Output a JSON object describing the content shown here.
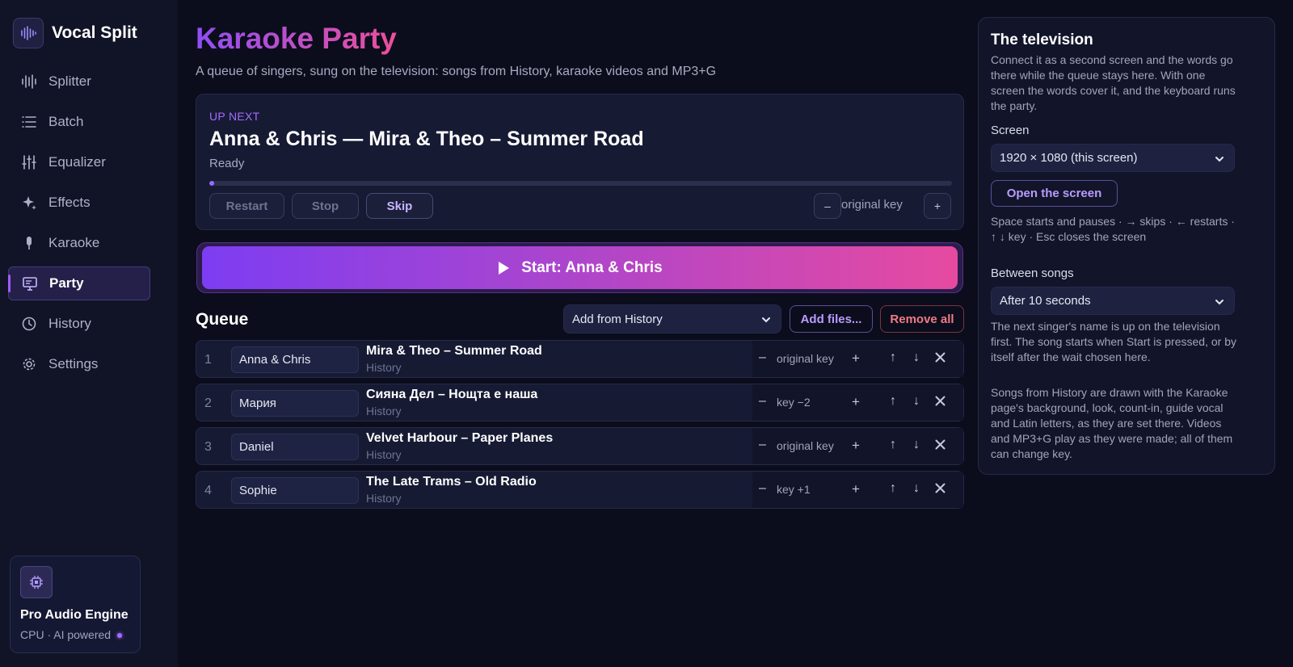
{
  "app": {
    "name": "Vocal Split"
  },
  "sidebar": {
    "items": [
      {
        "label": "Splitter",
        "icon": "waveform-icon"
      },
      {
        "label": "Batch",
        "icon": "list-icon"
      },
      {
        "label": "Equalizer",
        "icon": "sliders-icon"
      },
      {
        "label": "Effects",
        "icon": "sparkle-icon"
      },
      {
        "label": "Karaoke",
        "icon": "microphone-icon"
      },
      {
        "label": "Party",
        "icon": "monitor-icon",
        "active": true
      },
      {
        "label": "History",
        "icon": "clock-icon"
      },
      {
        "label": "Settings",
        "icon": "gear-icon"
      }
    ],
    "engine": {
      "title": "Pro Audio Engine",
      "subtitle": "CPU · AI powered"
    }
  },
  "header": {
    "title": "Karaoke Party",
    "subtitle": "A queue of singers, sung on the television: songs from History, karaoke videos and MP3+G"
  },
  "up_next": {
    "label": "UP NEXT",
    "title": "Anna & Chris — Mira & Theo – Summer Road",
    "status": "Ready",
    "progress": 0.006,
    "buttons": {
      "restart": "Restart",
      "stop": "Stop",
      "skip": "Skip"
    },
    "key": {
      "minus": "–",
      "label": "original key",
      "plus": "+"
    }
  },
  "start_button": {
    "label": "Start: Anna & Chris"
  },
  "queue": {
    "title": "Queue",
    "add_from": "Add from History",
    "add_files": "Add files...",
    "remove_all": "Remove all",
    "rows": [
      {
        "num": "1",
        "singer": "Anna & Chris",
        "song": "Mira & Theo – Summer Road",
        "source": "History",
        "key": "original key"
      },
      {
        "num": "2",
        "singer": "Мария",
        "song": "Сияна Дел – Нощта е наша",
        "source": "History",
        "key": "key −2"
      },
      {
        "num": "3",
        "singer": "Daniel",
        "song": "Velvet Harbour – Paper Planes",
        "source": "History",
        "key": "original key"
      },
      {
        "num": "4",
        "singer": "Sophie",
        "song": "The Late Trams – Old Radio",
        "source": "History",
        "key": "key +1"
      }
    ],
    "row_controls": {
      "minus": "–",
      "plus": "+",
      "up": "↑",
      "down": "↓"
    }
  },
  "tv": {
    "title": "The television",
    "intro": "Connect it as a second screen and the words go there while the queue stays here. With one screen the words cover it, and the keyboard runs the party.",
    "screen_label": "Screen",
    "screen_value": "1920 × 1080 (this screen)",
    "open_button": "Open the screen",
    "shortcuts": "Space starts and pauses · → skips · ← restarts · ↑ ↓ key · Esc closes the screen",
    "between_label": "Between songs",
    "between_value": "After 10 seconds",
    "between_note": "The next singer's name is up on the television first. The song starts when Start is pressed, or by itself after the wait chosen here.",
    "history_note": "Songs from History are drawn with the Karaoke page's background, look, count-in, guide vocal and Latin letters, as they are set there. Videos and MP3+G play as they were made; all of them can change key."
  },
  "colors": {
    "accent": "#a56bff",
    "gradient_start": "#7d3df2",
    "gradient_end": "#e64aa0",
    "danger": "#f07a86"
  }
}
